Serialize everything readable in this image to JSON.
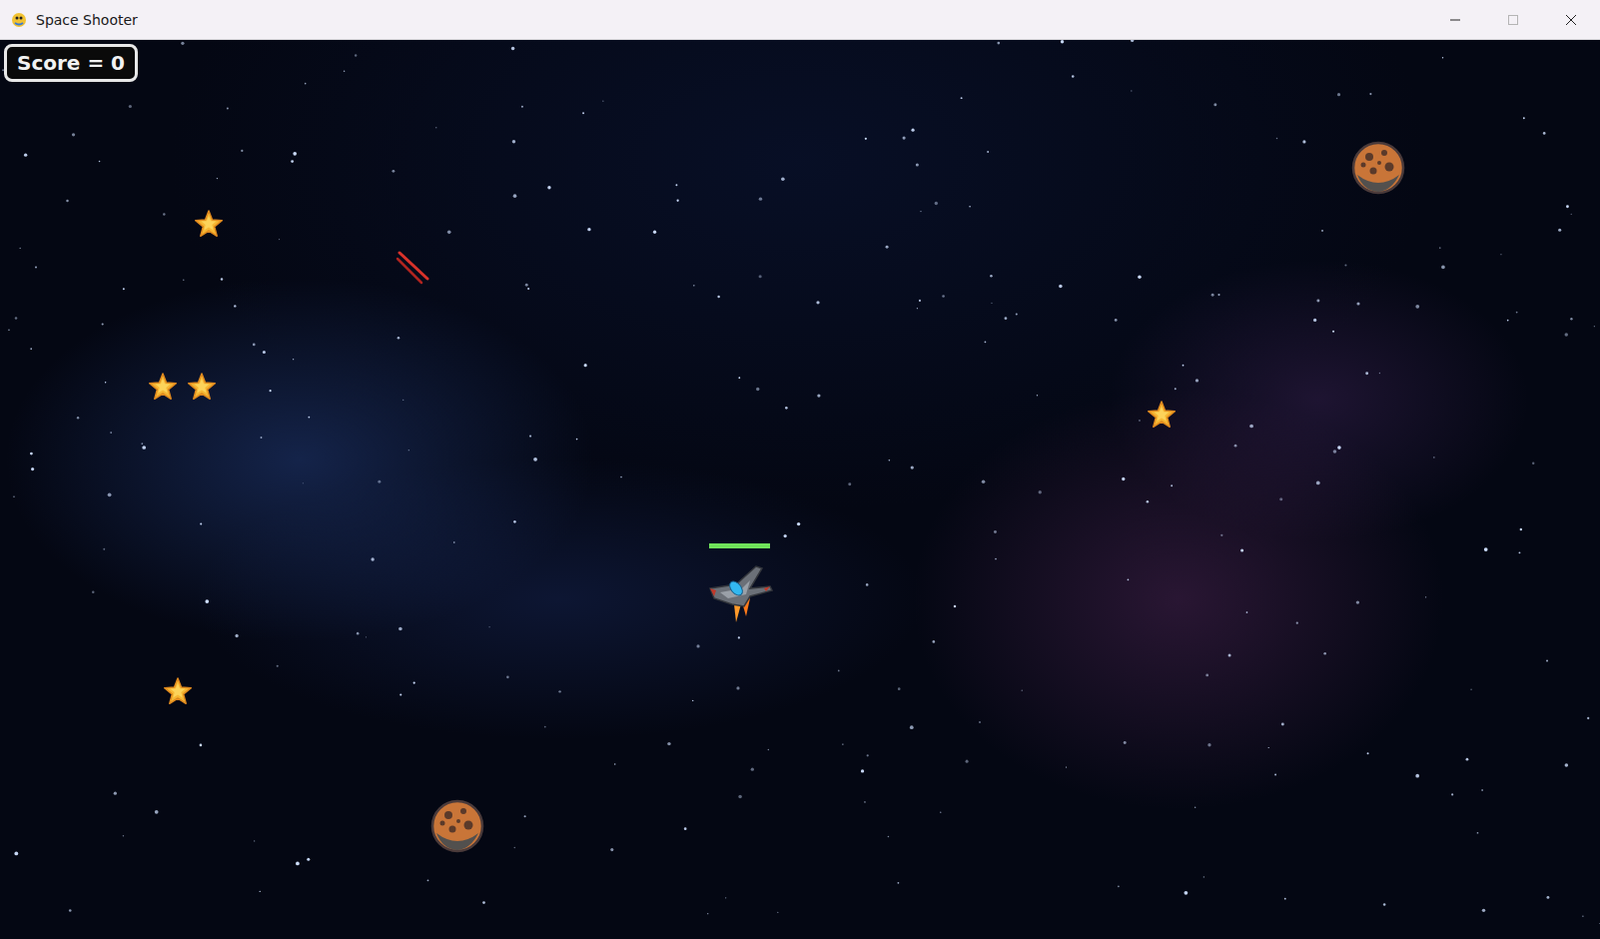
{
  "window": {
    "title": "Space Shooter"
  },
  "hud": {
    "score": "Score = 0"
  },
  "player": {
    "health": 1.0
  },
  "entities": [
    {
      "kind": "star"
    },
    {
      "kind": "star"
    },
    {
      "kind": "star"
    },
    {
      "kind": "star"
    },
    {
      "kind": "star"
    },
    {
      "kind": "asteroid"
    },
    {
      "kind": "asteroid"
    },
    {
      "kind": "laser"
    }
  ]
}
